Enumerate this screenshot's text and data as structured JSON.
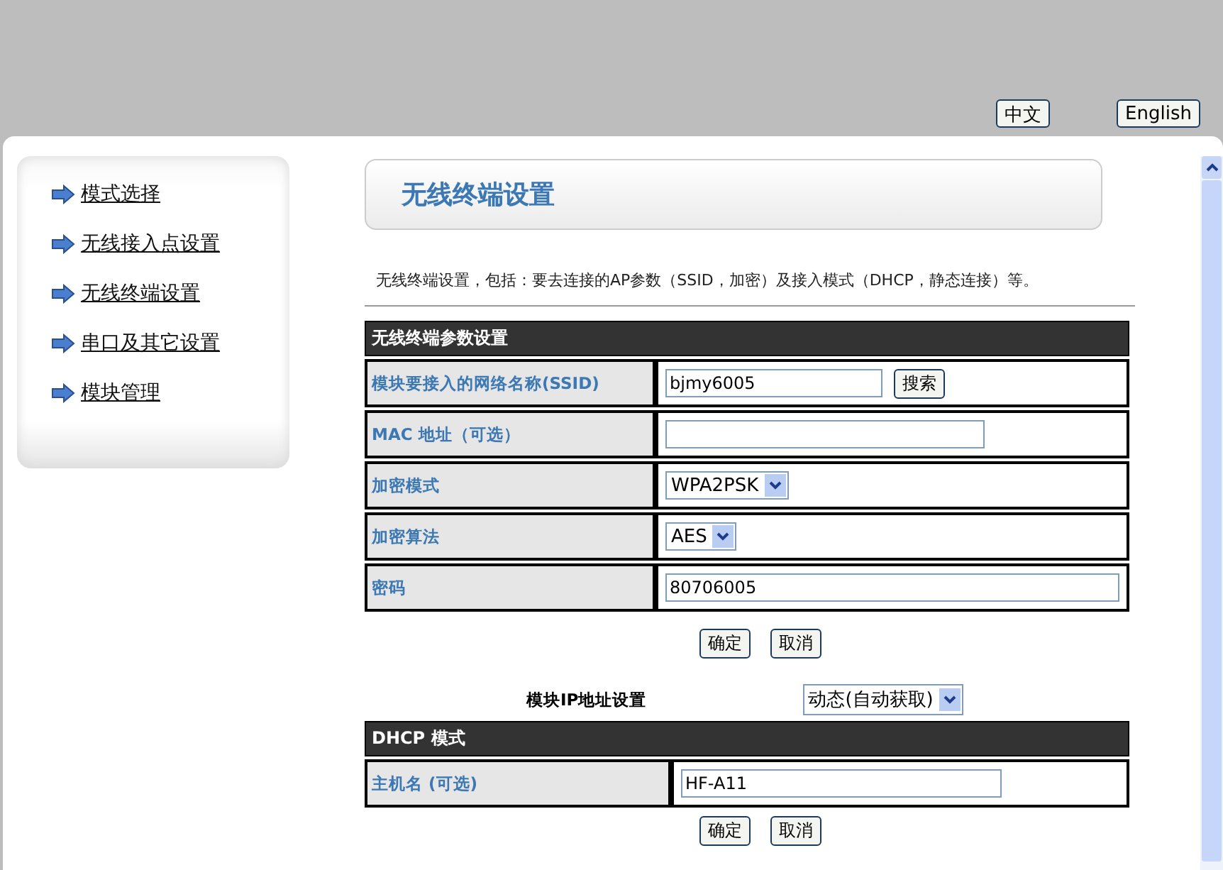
{
  "language_buttons": [
    "中文",
    "English"
  ],
  "sidebar": {
    "items": [
      {
        "label": "模式选择"
      },
      {
        "label": "无线接入点设置"
      },
      {
        "label": "无线终端设置"
      },
      {
        "label": "串口及其它设置"
      },
      {
        "label": "模块管理"
      }
    ]
  },
  "page_title": "无线终端设置",
  "description": "无线终端设置，包括：要去连接的AP参数（SSID，加密）及接入模式（DHCP，静态连接）等。",
  "wireless_table": {
    "header": "无线终端参数设置",
    "rows": [
      {
        "kind": "text",
        "label": "模块要接入的网络名称(SSID)",
        "value": "bjmy6005",
        "button": "搜索"
      },
      {
        "kind": "text",
        "label": "MAC 地址（可选）"
      },
      {
        "kind": "select",
        "label": "加密模式",
        "value": "WPA2PSK"
      },
      {
        "kind": "select",
        "label": "加密算法",
        "value": "AES"
      },
      {
        "kind": "wide",
        "label": "密码",
        "value": "80706005"
      }
    ]
  },
  "actions_1": [
    "确定",
    "取消"
  ],
  "ip_setting": {
    "label": "模块IP地址设置",
    "value": "动态(自动获取)"
  },
  "dhcp_table": {
    "header": "DHCP 模式",
    "rows": [
      {
        "kind": "wide",
        "label": "主机名 (可选)",
        "value": "HF-A11"
      }
    ]
  },
  "actions_2": [
    "确定",
    "取消"
  ]
}
